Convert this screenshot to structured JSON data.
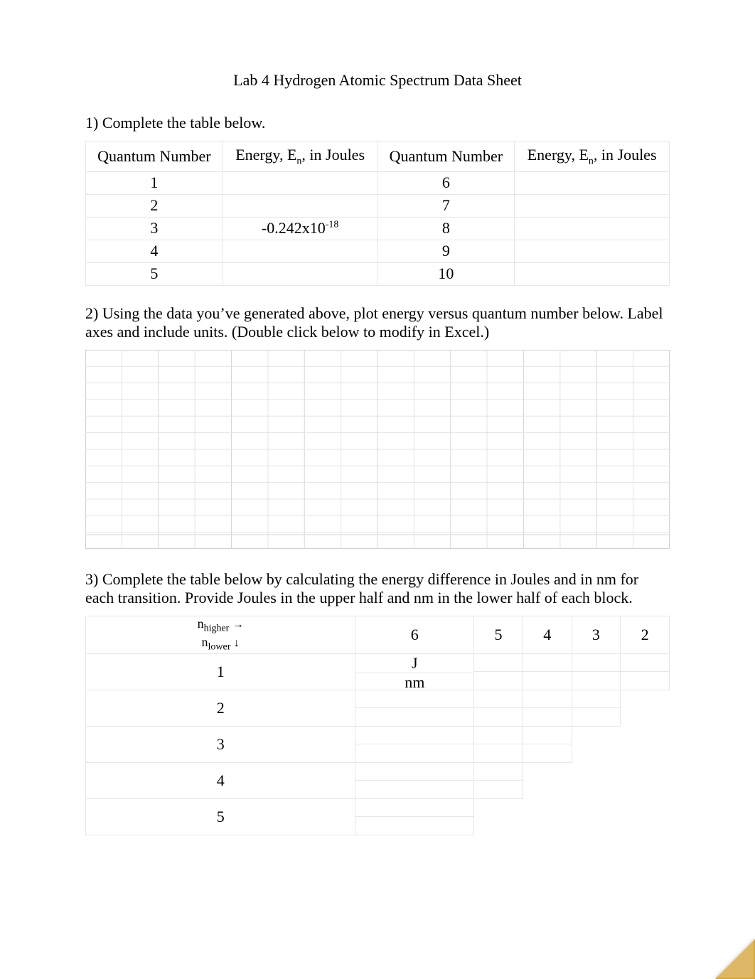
{
  "title": "Lab 4 Hydrogen Atomic Spectrum Data Sheet",
  "q1": {
    "prompt": "1)  Complete the table below.",
    "headers": {
      "left_qn": "Quantum Number",
      "left_en_prefix": "Energy, E",
      "left_en_sub": "n",
      "left_en_suffix": ", in Joules",
      "right_qn": "Quantum Number",
      "right_en_prefix": "Energy, E",
      "right_en_sub": "n",
      "right_en_suffix": ", in Joules"
    },
    "rows": [
      {
        "ln": "1",
        "le": "",
        "rn": "6",
        "re": ""
      },
      {
        "ln": "2",
        "le": "",
        "rn": "7",
        "re": ""
      },
      {
        "ln": "3",
        "le_pre": "-0.242x10",
        "le_sup": "-18",
        "rn": "8",
        "re": ""
      },
      {
        "ln": "4",
        "le": "",
        "rn": "9",
        "re": ""
      },
      {
        "ln": "5",
        "le": "",
        "rn": "10",
        "re": ""
      }
    ]
  },
  "q2": {
    "prompt": "2)  Using the data you’ve generated above, plot energy versus quantum number below. Label axes and include units. (Double click below to modify in Excel.)"
  },
  "chart_data": {
    "type": "scatter",
    "title": "",
    "xlabel": "",
    "ylabel": "",
    "x": [],
    "y": [],
    "grid": true,
    "notes": "Blank plotting grid shown in screenshot; no data points or axis labels present."
  },
  "q3": {
    "prompt": "3)  Complete the table below by calculating the energy difference in Joules and in nm for each transition. Provide Joules in the upper half and nm in the lower half of each block.",
    "corner": {
      "line1_prefix": "n",
      "line1_sub": "higher",
      "line1_arrow": "→",
      "line2_prefix": "n",
      "line2_sub": "lower",
      "line2_arrow": "↓"
    },
    "col_headers": [
      "6",
      "5",
      "4",
      "3",
      "2"
    ],
    "row_headers": [
      "1",
      "2",
      "3",
      "4",
      "5"
    ],
    "first_cell": {
      "top": "J",
      "bottom": "nm"
    }
  }
}
